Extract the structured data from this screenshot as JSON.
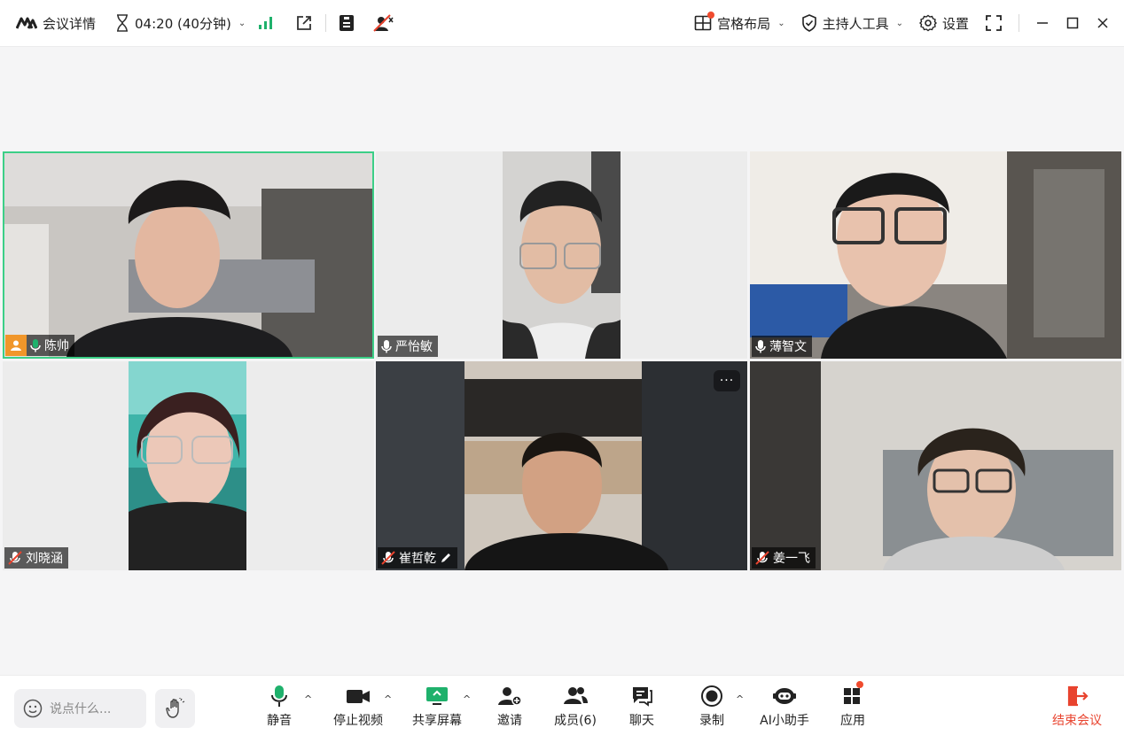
{
  "topbar": {
    "meeting_details": "会议详情",
    "timer": "04:20 (40分钟)",
    "layout_label": "宫格布局",
    "host_tools_label": "主持人工具",
    "settings_label": "设置"
  },
  "participants": [
    {
      "name": "陈帅",
      "mic": "on",
      "host": true,
      "active_speaker": true
    },
    {
      "name": "严怡敏",
      "mic": "on"
    },
    {
      "name": "薄智文",
      "mic": "on"
    },
    {
      "name": "刘晓涵",
      "mic": "muted"
    },
    {
      "name": "崔哲乾",
      "mic": "muted",
      "editing": true
    },
    {
      "name": "姜一飞",
      "mic": "muted"
    }
  ],
  "bottombar": {
    "chat_placeholder": "说点什么...",
    "mute": "静音",
    "stop_video": "停止视频",
    "share_screen": "共享屏幕",
    "invite": "邀请",
    "members": "成员(6)",
    "chat": "聊天",
    "record": "录制",
    "ai_assistant": "AI小助手",
    "apps": "应用",
    "end_meeting": "结束会议"
  },
  "colors": {
    "accent_green": "#1fb16c",
    "active_border": "#3ccf87",
    "end_red": "#e8432e",
    "host_badge": "#f0962a",
    "notify_dot": "#f04b2e"
  }
}
